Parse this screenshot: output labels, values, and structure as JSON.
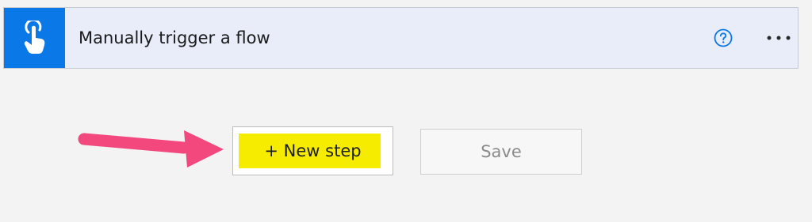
{
  "trigger": {
    "title": "Manually trigger a flow",
    "icon": "touch-icon",
    "help_icon": "help-icon",
    "more_icon": "more-options-icon"
  },
  "actions": {
    "new_step_label": "+ New step",
    "save_label": "Save"
  },
  "colors": {
    "trigger_icon_bg": "#0a78e6",
    "trigger_card_bg": "#e8edf9",
    "highlight": "#f6ec00",
    "annotation_arrow": "#f2487e"
  }
}
